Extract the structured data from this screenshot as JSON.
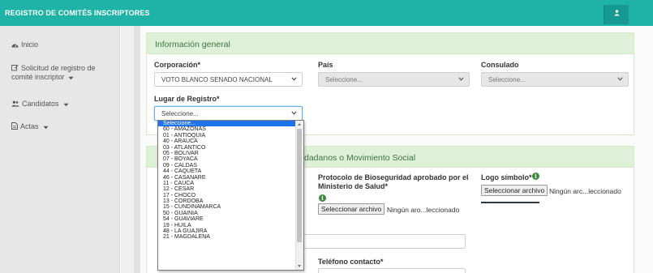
{
  "topbar": {
    "title": "REGISTRO DE COMITÉS INSCRIPTORES",
    "user_icon": "user-icon",
    "bg_color": "#1fb2a7"
  },
  "sidebar": {
    "items": [
      {
        "icon": "dashboard-icon",
        "label": "Inicio"
      },
      {
        "icon": "edit-icon",
        "label_line1": "Solicitud de registro de",
        "label_line2": "comité inscriptor"
      },
      {
        "icon": "users-icon",
        "label": "Candidatos"
      },
      {
        "icon": "file-icon",
        "label": "Actas"
      }
    ]
  },
  "panel_general": {
    "heading": "Información general",
    "corporacion": {
      "label": "Corporación*",
      "value": "VOTO BLANCO SENADO NACIONAL"
    },
    "pais": {
      "label": "País",
      "value": "Seleccione..."
    },
    "consulado": {
      "label": "Consulado",
      "value": "Seleccione..."
    },
    "lugar": {
      "label": "Lugar de Registro*",
      "value": "Seleccione..."
    }
  },
  "panel_second": {
    "heading_visible": "dadanos o Movimiento Social",
    "protocolo": {
      "label_line1": "Protocolo de Bioseguridad aprobado por el",
      "label_line2": "Ministerio de Salud*",
      "button": "Seleccionar archivo",
      "file_text": "Ningún aro...leccionado"
    },
    "logo": {
      "label": "Logo símbolo*",
      "button": "Seleccionar archivo",
      "file_text": "Ningún arc...leccionado"
    },
    "telefono": {
      "label": "Teléfono contacto*"
    }
  },
  "dropdown": {
    "options": [
      "Seleccione...",
      "60 - AMAZONAS",
      "01 - ANTIOQUIA",
      "40 - ARAUCA",
      "03 - ATLANTICO",
      "05 - BOLIVAR",
      "07 - BOYACA",
      "09 - CALDAS",
      "44 - CAQUETA",
      "46 - CASANARE",
      "11 - CAUCA",
      "12 - CESAR",
      "17 - CHOCO",
      "13 - CORDOBA",
      "15 - CUNDINAMARCA",
      "50 - GUAINIA",
      "54 - GUAVIARE",
      "19 - HUILA",
      "48 - LA GUAJIRA",
      "21 - MAGDALENA"
    ]
  }
}
